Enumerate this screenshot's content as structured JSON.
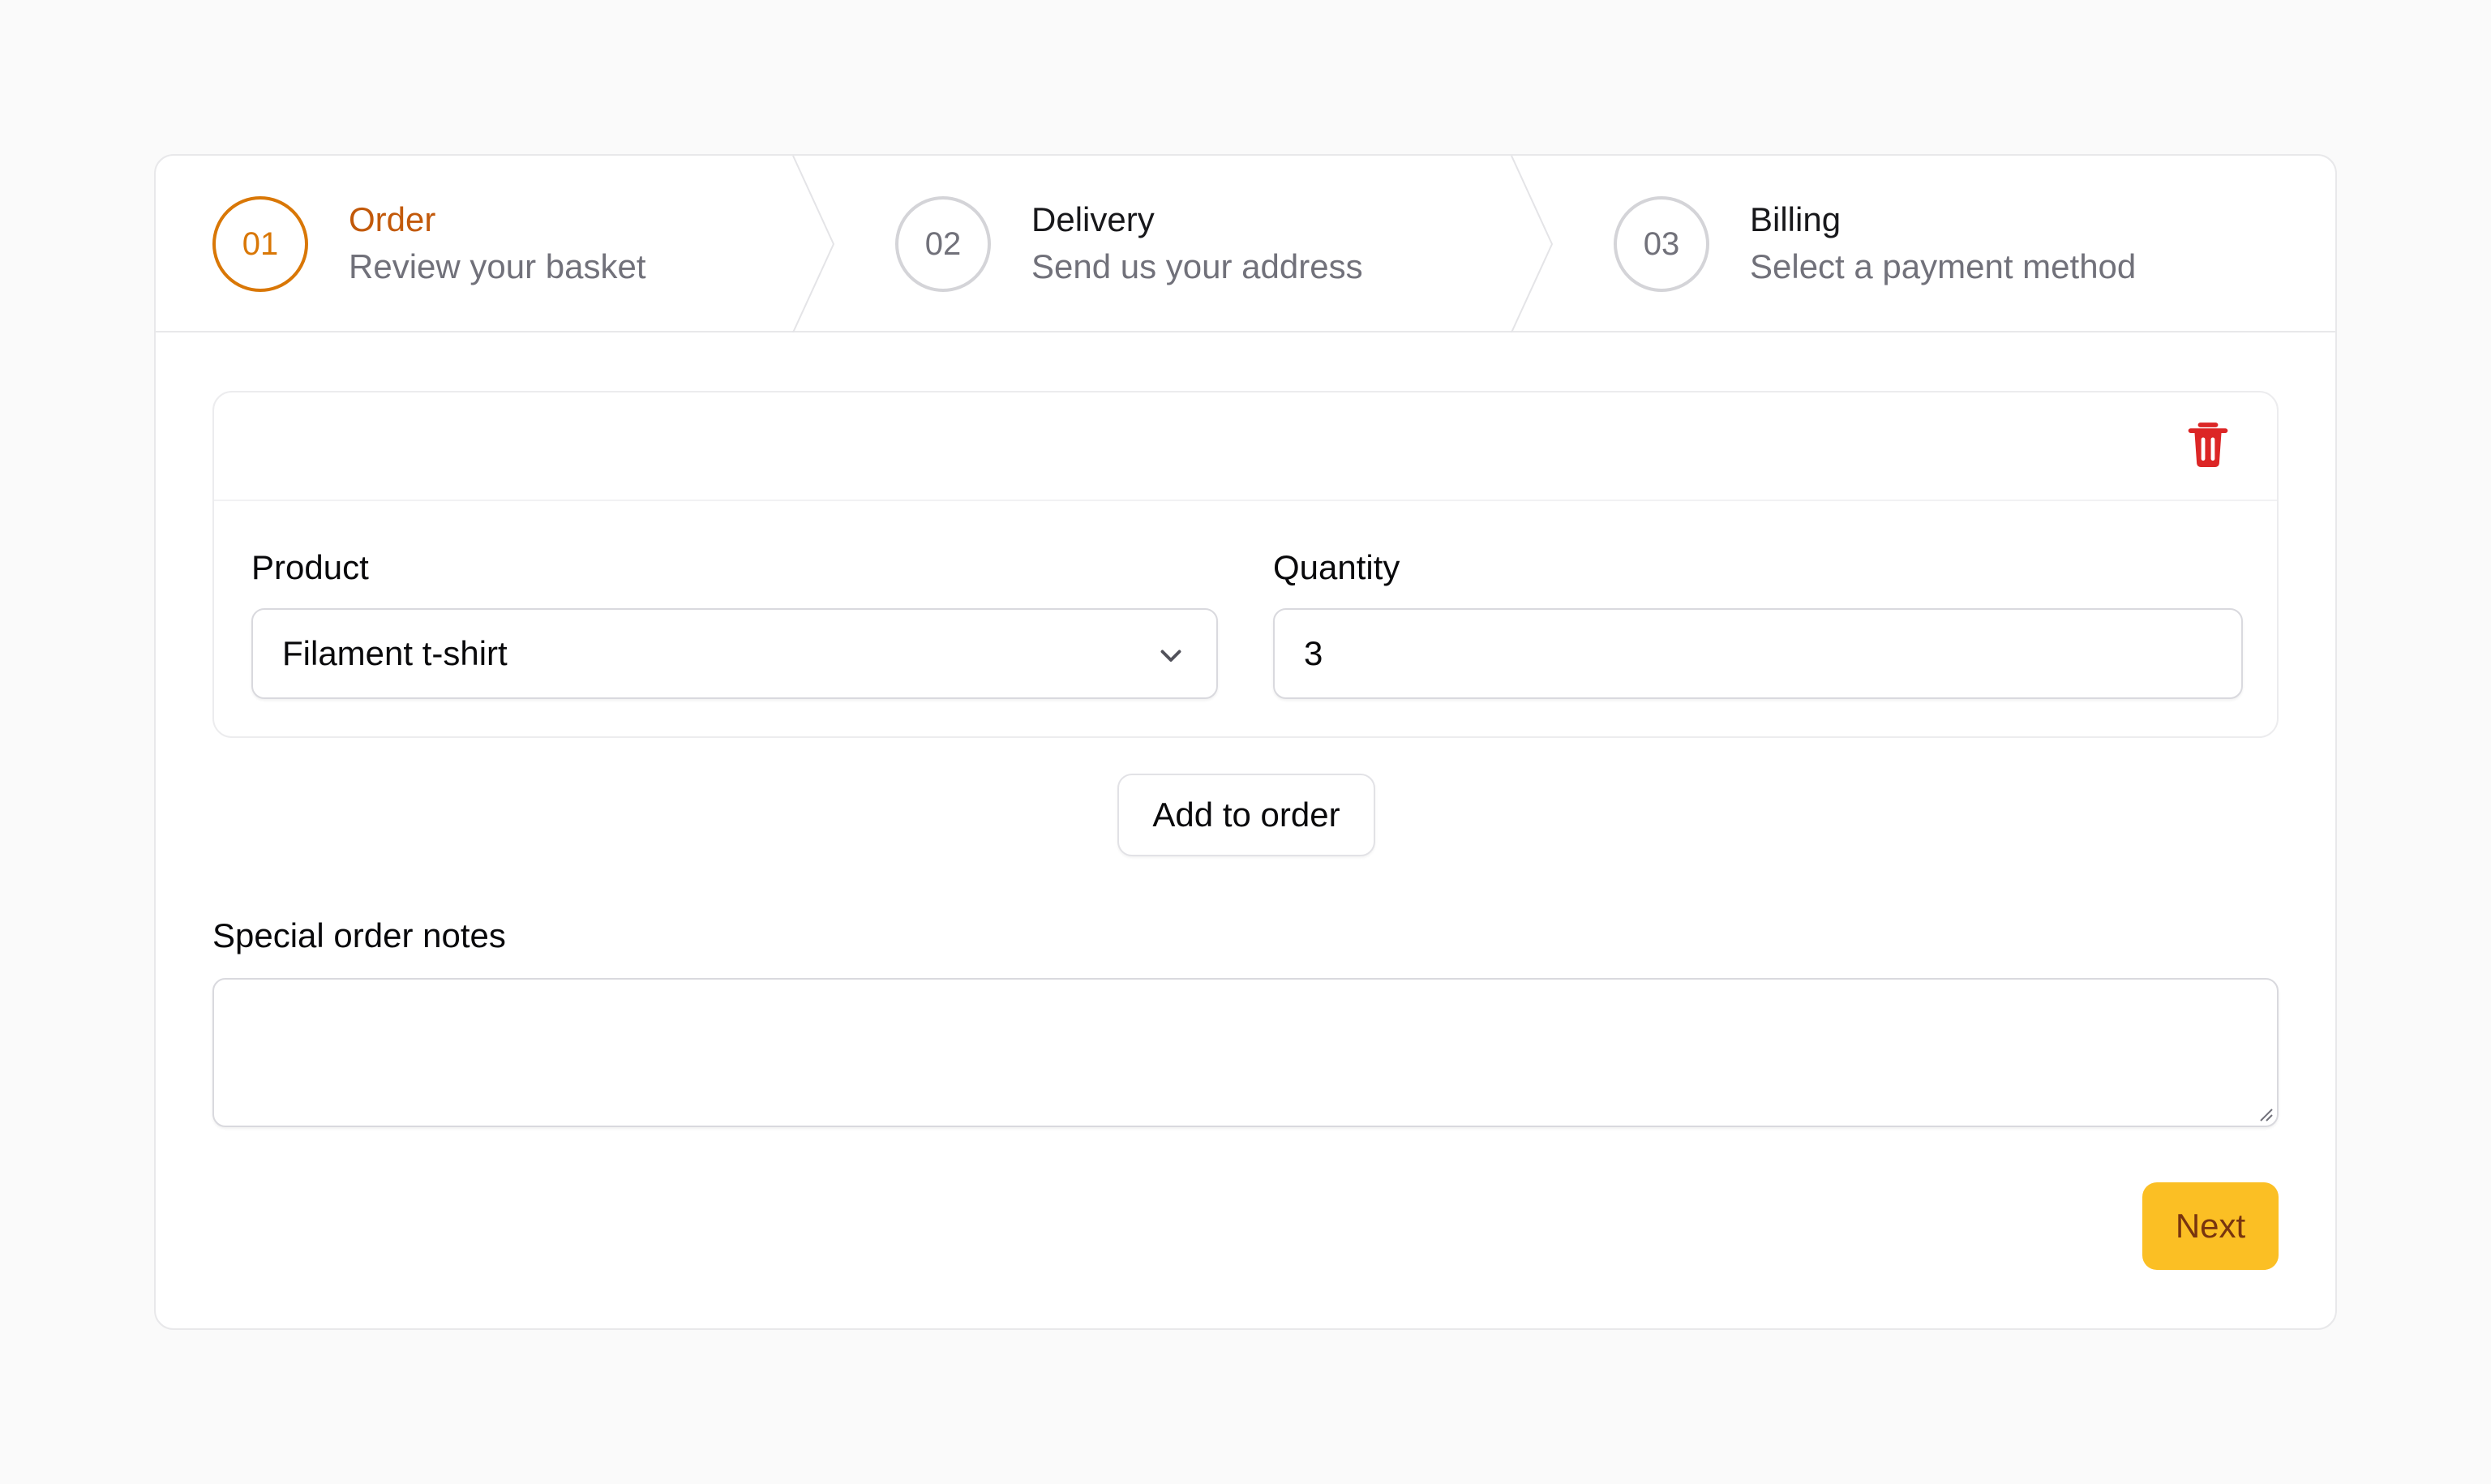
{
  "steps": [
    {
      "number": "01",
      "title": "Order",
      "description": "Review your basket"
    },
    {
      "number": "02",
      "title": "Delivery",
      "description": "Send us your address"
    },
    {
      "number": "03",
      "title": "Billing",
      "description": "Select a payment method"
    }
  ],
  "order_item": {
    "product_label": "Product",
    "product_value": "Filament t-shirt",
    "quantity_label": "Quantity",
    "quantity_value": "3"
  },
  "add_button_label": "Add to order",
  "notes": {
    "label": "Special order notes",
    "value": ""
  },
  "next_button_label": "Next",
  "colors": {
    "accent": "#d97706",
    "primary_button": "#fbbf24",
    "danger": "#dc2626"
  }
}
